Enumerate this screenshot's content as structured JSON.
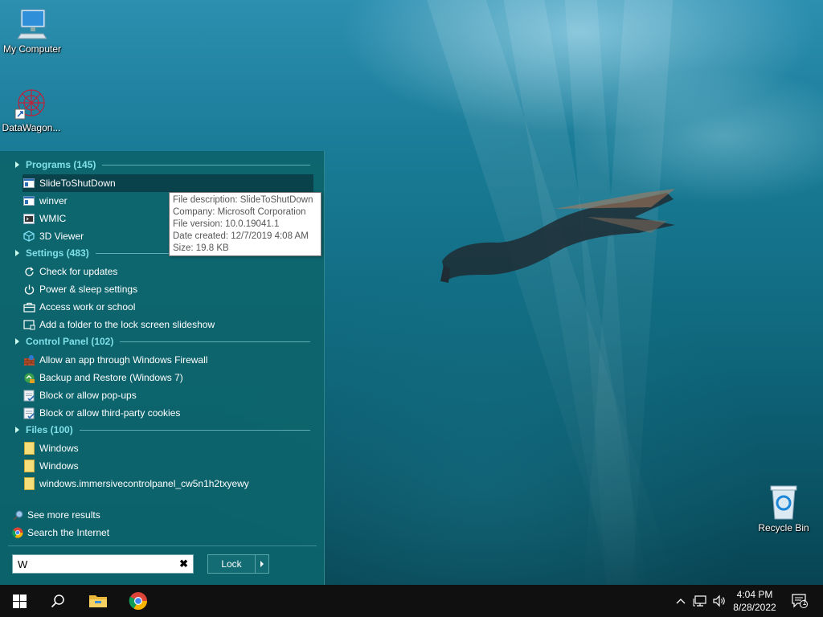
{
  "desktop": {
    "icons": {
      "my_computer": "My Computer",
      "datawagon": "DataWagon...",
      "recycle_bin": "Recycle Bin"
    }
  },
  "start_menu": {
    "sections": {
      "programs": "Programs (145)",
      "settings": "Settings (483)",
      "control_panel": "Control Panel (102)",
      "files": "Files (100)"
    },
    "programs": [
      {
        "label": "SlideToShutDown",
        "icon": "window-app-icon"
      },
      {
        "label": "winver",
        "icon": "window-app-icon"
      },
      {
        "label": "WMIC",
        "icon": "console-app-icon"
      },
      {
        "label": "3D Viewer",
        "icon": "cube-icon"
      }
    ],
    "settings": [
      {
        "label": "Check for updates",
        "icon": "refresh-icon"
      },
      {
        "label": "Power & sleep settings",
        "icon": "power-icon"
      },
      {
        "label": "Access work or school",
        "icon": "briefcase-icon"
      },
      {
        "label": "Add a folder to the lock screen slideshow",
        "icon": "slideshow-icon"
      }
    ],
    "control_panel": [
      {
        "label": "Allow an app through Windows Firewall",
        "icon": "firewall-icon"
      },
      {
        "label": "Backup and Restore (Windows 7)",
        "icon": "backup-icon"
      },
      {
        "label": "Block or allow pop-ups",
        "icon": "internet-options-icon"
      },
      {
        "label": "Block or allow third-party cookies",
        "icon": "internet-options-icon"
      }
    ],
    "files": [
      {
        "label": "Windows",
        "icon": "folder-icon"
      },
      {
        "label": "Windows",
        "icon": "folder-icon"
      },
      {
        "label": "windows.immersivecontrolpanel_cw5n1h2txyewy",
        "icon": "folder-icon"
      }
    ],
    "see_more": "See more results",
    "search_internet": "Search the Internet",
    "search_value": "W",
    "lock_label": "Lock"
  },
  "tooltip": {
    "description": "File description: SlideToShutDown",
    "company": "Company: Microsoft Corporation",
    "version": "File version: 10.0.19041.1",
    "created": "Date created: 12/7/2019 4:08 AM",
    "size": "Size: 19.8 KB"
  },
  "taskbar": {
    "time": "4:04 PM",
    "date": "8/28/2022",
    "notification_count": "1"
  }
}
